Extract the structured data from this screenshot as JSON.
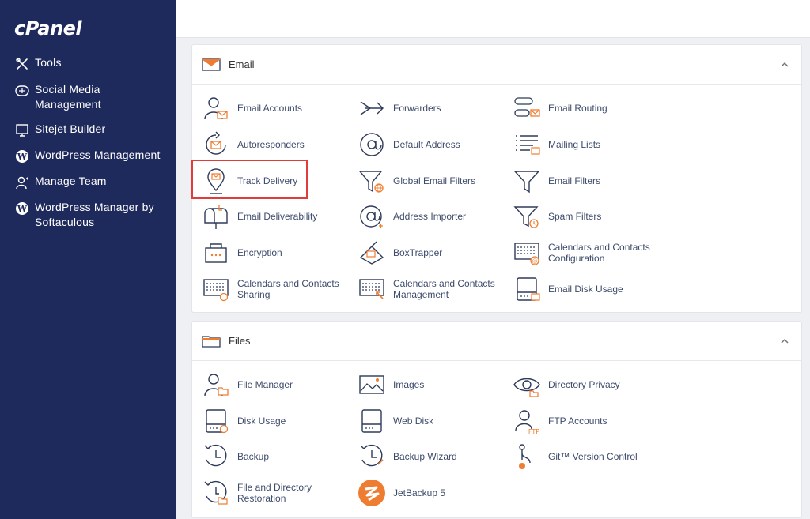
{
  "brand": {
    "logo_text": "cPanel"
  },
  "colors": {
    "sidebar_bg": "#1f2a5c",
    "accent_orange": "#ef7d31",
    "highlight_red": "#e23b3b",
    "icon_dark": "#2e3a59"
  },
  "sidebar": {
    "items": [
      {
        "label": "Tools",
        "icon": "tools-icon"
      },
      {
        "label": "Social Media\nManagement",
        "icon": "social-media-icon"
      },
      {
        "label": "Sitejet Builder",
        "icon": "sitejet-icon"
      },
      {
        "label": "WordPress Management",
        "icon": "wordpress-icon"
      },
      {
        "label": "Manage Team",
        "icon": "team-icon"
      },
      {
        "label": "WordPress Manager by\nSoftaculous",
        "icon": "wordpress-icon"
      }
    ]
  },
  "email": {
    "title": "Email",
    "items": [
      {
        "label": "Email Accounts",
        "icon": "email-accounts-icon"
      },
      {
        "label": "Forwarders",
        "icon": "forwarders-icon"
      },
      {
        "label": "Email Routing",
        "icon": "email-routing-icon"
      },
      {
        "label": "Autoresponders",
        "icon": "autoresponders-icon"
      },
      {
        "label": "Default Address",
        "icon": "at-sign-icon"
      },
      {
        "label": "Mailing Lists",
        "icon": "mailing-lists-icon"
      },
      {
        "label": "Track Delivery",
        "icon": "track-delivery-icon"
      },
      {
        "label": "Global Email Filters",
        "icon": "global-filter-icon"
      },
      {
        "label": "Email Filters",
        "icon": "filter-icon"
      },
      {
        "label": "Email Deliverability",
        "icon": "mailbox-icon"
      },
      {
        "label": "Address Importer",
        "icon": "address-importer-icon"
      },
      {
        "label": "Spam Filters",
        "icon": "spam-filter-icon"
      },
      {
        "label": "Encryption",
        "icon": "encryption-icon"
      },
      {
        "label": "BoxTrapper",
        "icon": "boxtrapper-icon"
      },
      {
        "label": "Calendars and Contacts\nConfiguration",
        "icon": "calendar-config-icon"
      },
      {
        "label": "Calendars and Contacts\nSharing",
        "icon": "calendar-sharing-icon"
      },
      {
        "label": "Calendars and Contacts\nManagement",
        "icon": "calendar-management-icon"
      },
      {
        "label": "Email Disk Usage",
        "icon": "disk-usage-icon"
      }
    ]
  },
  "files": {
    "title": "Files",
    "items": [
      {
        "label": "File Manager",
        "icon": "file-manager-icon"
      },
      {
        "label": "Images",
        "icon": "images-icon"
      },
      {
        "label": "Directory Privacy",
        "icon": "eye-icon"
      },
      {
        "label": "Disk Usage",
        "icon": "disk-icon"
      },
      {
        "label": "Web Disk",
        "icon": "web-disk-icon"
      },
      {
        "label": "FTP Accounts",
        "icon": "ftp-icon"
      },
      {
        "label": "Backup",
        "icon": "backup-icon"
      },
      {
        "label": "Backup Wizard",
        "icon": "backup-wizard-icon"
      },
      {
        "label": "Git™ Version Control",
        "icon": "git-icon"
      },
      {
        "label": "File and Directory\nRestoration",
        "icon": "restore-icon"
      },
      {
        "label": "JetBackup 5",
        "icon": "jetbackup-icon"
      }
    ]
  }
}
